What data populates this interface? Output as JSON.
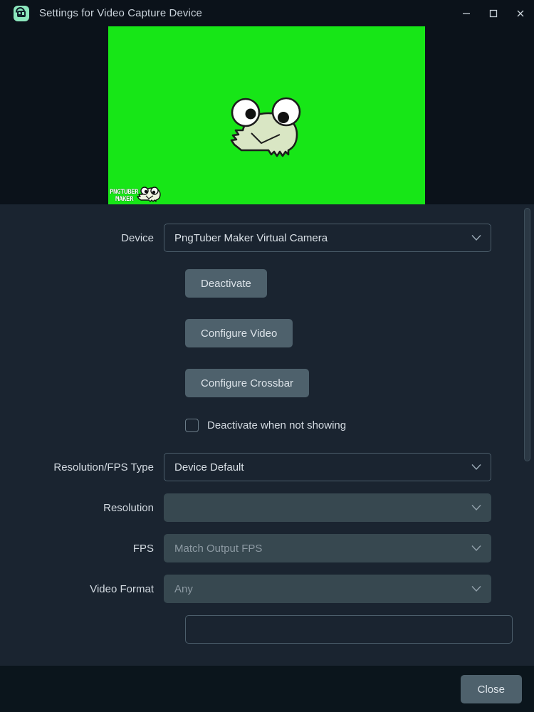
{
  "window": {
    "title": "Settings for Video Capture Device",
    "app_icon": "video-camera-icon",
    "controls": {
      "minimize": "minimize-icon",
      "maximize": "maximize-icon",
      "close": "close-icon"
    }
  },
  "preview": {
    "background_color": "#17e617",
    "character": "frog-avatar",
    "watermark_line1": "PNGTUBER",
    "watermark_line2": "MAKER"
  },
  "form": {
    "device": {
      "label": "Device",
      "value": "PngTuber Maker Virtual Camera",
      "enabled": true
    },
    "buttons": {
      "deactivate": "Deactivate",
      "configure_video": "Configure Video",
      "configure_crossbar": "Configure Crossbar"
    },
    "deactivate_when_not_showing": {
      "label": "Deactivate when not showing",
      "checked": false
    },
    "resolution_fps_type": {
      "label": "Resolution/FPS Type",
      "value": "Device Default",
      "enabled": true
    },
    "resolution": {
      "label": "Resolution",
      "value": "",
      "enabled": false
    },
    "fps": {
      "label": "FPS",
      "value": "Match Output FPS",
      "enabled": false
    },
    "video_format": {
      "label": "Video Format",
      "value": "Any",
      "enabled": false
    }
  },
  "footer": {
    "close_label": "Close"
  },
  "colors": {
    "window_chrome": "#0b121a",
    "body_background": "#1a2430",
    "footer_background": "#0b151c",
    "button_fill": "#4e616c",
    "disabled_field": "#374850",
    "accent_green": "#8ce6bd",
    "chroma_key_green": "#17e617"
  }
}
